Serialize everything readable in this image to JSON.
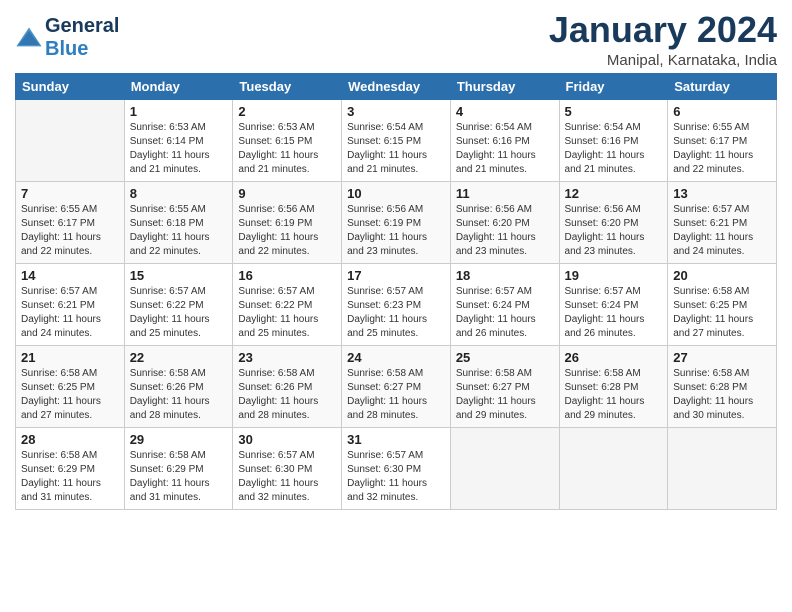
{
  "header": {
    "logo_line1": "General",
    "logo_line2": "Blue",
    "month": "January 2024",
    "location": "Manipal, Karnataka, India"
  },
  "weekdays": [
    "Sunday",
    "Monday",
    "Tuesday",
    "Wednesday",
    "Thursday",
    "Friday",
    "Saturday"
  ],
  "weeks": [
    [
      {
        "day": "",
        "info": ""
      },
      {
        "day": "1",
        "info": "Sunrise: 6:53 AM\nSunset: 6:14 PM\nDaylight: 11 hours\nand 21 minutes."
      },
      {
        "day": "2",
        "info": "Sunrise: 6:53 AM\nSunset: 6:15 PM\nDaylight: 11 hours\nand 21 minutes."
      },
      {
        "day": "3",
        "info": "Sunrise: 6:54 AM\nSunset: 6:15 PM\nDaylight: 11 hours\nand 21 minutes."
      },
      {
        "day": "4",
        "info": "Sunrise: 6:54 AM\nSunset: 6:16 PM\nDaylight: 11 hours\nand 21 minutes."
      },
      {
        "day": "5",
        "info": "Sunrise: 6:54 AM\nSunset: 6:16 PM\nDaylight: 11 hours\nand 21 minutes."
      },
      {
        "day": "6",
        "info": "Sunrise: 6:55 AM\nSunset: 6:17 PM\nDaylight: 11 hours\nand 22 minutes."
      }
    ],
    [
      {
        "day": "7",
        "info": "Sunrise: 6:55 AM\nSunset: 6:17 PM\nDaylight: 11 hours\nand 22 minutes."
      },
      {
        "day": "8",
        "info": "Sunrise: 6:55 AM\nSunset: 6:18 PM\nDaylight: 11 hours\nand 22 minutes."
      },
      {
        "day": "9",
        "info": "Sunrise: 6:56 AM\nSunset: 6:19 PM\nDaylight: 11 hours\nand 22 minutes."
      },
      {
        "day": "10",
        "info": "Sunrise: 6:56 AM\nSunset: 6:19 PM\nDaylight: 11 hours\nand 23 minutes."
      },
      {
        "day": "11",
        "info": "Sunrise: 6:56 AM\nSunset: 6:20 PM\nDaylight: 11 hours\nand 23 minutes."
      },
      {
        "day": "12",
        "info": "Sunrise: 6:56 AM\nSunset: 6:20 PM\nDaylight: 11 hours\nand 23 minutes."
      },
      {
        "day": "13",
        "info": "Sunrise: 6:57 AM\nSunset: 6:21 PM\nDaylight: 11 hours\nand 24 minutes."
      }
    ],
    [
      {
        "day": "14",
        "info": "Sunrise: 6:57 AM\nSunset: 6:21 PM\nDaylight: 11 hours\nand 24 minutes."
      },
      {
        "day": "15",
        "info": "Sunrise: 6:57 AM\nSunset: 6:22 PM\nDaylight: 11 hours\nand 25 minutes."
      },
      {
        "day": "16",
        "info": "Sunrise: 6:57 AM\nSunset: 6:22 PM\nDaylight: 11 hours\nand 25 minutes."
      },
      {
        "day": "17",
        "info": "Sunrise: 6:57 AM\nSunset: 6:23 PM\nDaylight: 11 hours\nand 25 minutes."
      },
      {
        "day": "18",
        "info": "Sunrise: 6:57 AM\nSunset: 6:24 PM\nDaylight: 11 hours\nand 26 minutes."
      },
      {
        "day": "19",
        "info": "Sunrise: 6:57 AM\nSunset: 6:24 PM\nDaylight: 11 hours\nand 26 minutes."
      },
      {
        "day": "20",
        "info": "Sunrise: 6:58 AM\nSunset: 6:25 PM\nDaylight: 11 hours\nand 27 minutes."
      }
    ],
    [
      {
        "day": "21",
        "info": "Sunrise: 6:58 AM\nSunset: 6:25 PM\nDaylight: 11 hours\nand 27 minutes."
      },
      {
        "day": "22",
        "info": "Sunrise: 6:58 AM\nSunset: 6:26 PM\nDaylight: 11 hours\nand 28 minutes."
      },
      {
        "day": "23",
        "info": "Sunrise: 6:58 AM\nSunset: 6:26 PM\nDaylight: 11 hours\nand 28 minutes."
      },
      {
        "day": "24",
        "info": "Sunrise: 6:58 AM\nSunset: 6:27 PM\nDaylight: 11 hours\nand 28 minutes."
      },
      {
        "day": "25",
        "info": "Sunrise: 6:58 AM\nSunset: 6:27 PM\nDaylight: 11 hours\nand 29 minutes."
      },
      {
        "day": "26",
        "info": "Sunrise: 6:58 AM\nSunset: 6:28 PM\nDaylight: 11 hours\nand 29 minutes."
      },
      {
        "day": "27",
        "info": "Sunrise: 6:58 AM\nSunset: 6:28 PM\nDaylight: 11 hours\nand 30 minutes."
      }
    ],
    [
      {
        "day": "28",
        "info": "Sunrise: 6:58 AM\nSunset: 6:29 PM\nDaylight: 11 hours\nand 31 minutes."
      },
      {
        "day": "29",
        "info": "Sunrise: 6:58 AM\nSunset: 6:29 PM\nDaylight: 11 hours\nand 31 minutes."
      },
      {
        "day": "30",
        "info": "Sunrise: 6:57 AM\nSunset: 6:30 PM\nDaylight: 11 hours\nand 32 minutes."
      },
      {
        "day": "31",
        "info": "Sunrise: 6:57 AM\nSunset: 6:30 PM\nDaylight: 11 hours\nand 32 minutes."
      },
      {
        "day": "",
        "info": ""
      },
      {
        "day": "",
        "info": ""
      },
      {
        "day": "",
        "info": ""
      }
    ]
  ]
}
